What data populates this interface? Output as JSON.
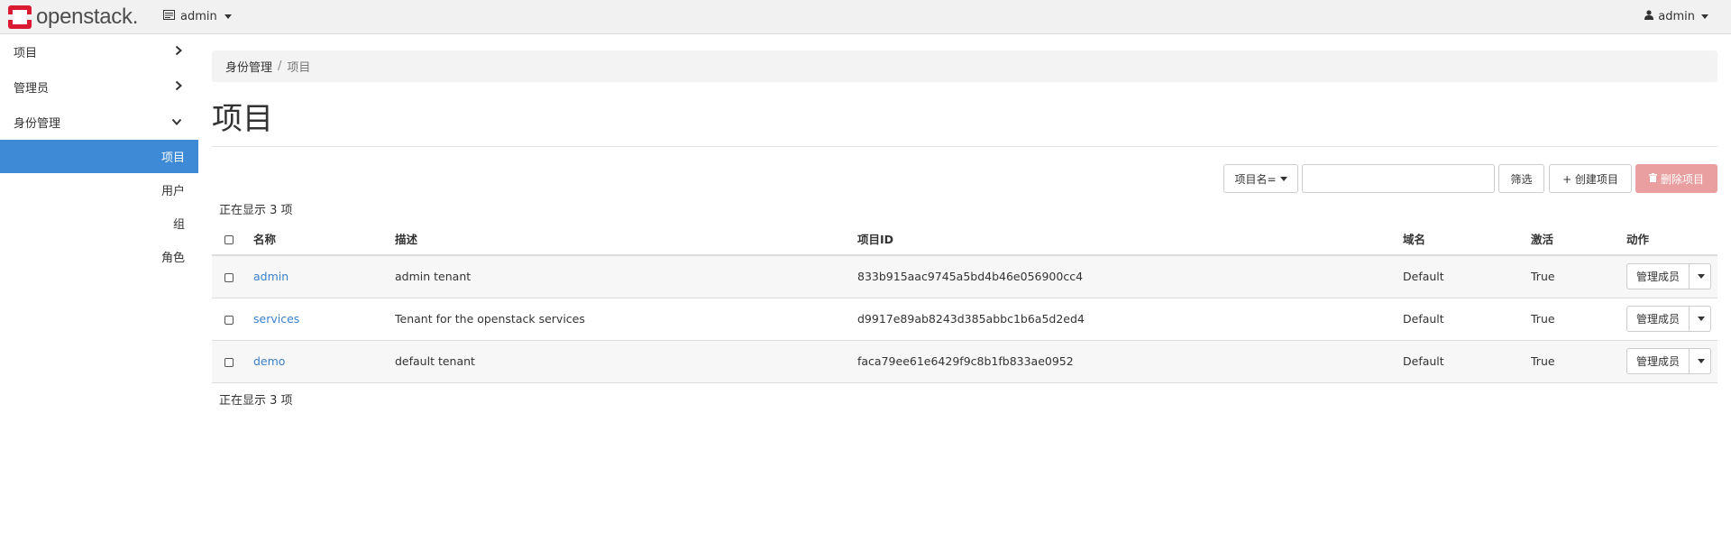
{
  "topbar": {
    "logo_text": "openstack.",
    "project_selector": "admin",
    "user": "admin",
    "icons": {
      "logo": "openstack-logo",
      "project": "project-card-icon",
      "user": "user-icon"
    }
  },
  "sidebar": {
    "items": [
      {
        "label": "项目",
        "state": "collapsed"
      },
      {
        "label": "管理员",
        "state": "collapsed"
      },
      {
        "label": "身份管理",
        "state": "expanded"
      }
    ],
    "identity_children": [
      {
        "label": "项目",
        "active": true
      },
      {
        "label": "用户",
        "active": false
      },
      {
        "label": "组",
        "active": false
      },
      {
        "label": "角色",
        "active": false
      }
    ]
  },
  "breadcrumb": {
    "parent": "身份管理",
    "separator": "/",
    "current": "项目"
  },
  "page": {
    "title": "项目"
  },
  "filter": {
    "field_selector": "项目名=",
    "value": "",
    "filter_button": "筛选",
    "create_button": "+ 创建项目",
    "delete_button": "删除项目"
  },
  "count_text_top": "正在显示 3 项",
  "count_text_bottom": "正在显示 3 项",
  "table": {
    "headers": {
      "name": "名称",
      "description": "描述",
      "project_id": "项目ID",
      "domain": "域名",
      "enabled": "激活",
      "actions": "动作"
    },
    "rows": [
      {
        "name": "admin",
        "description": "admin tenant",
        "project_id": "833b915aac9745a5bd4b46e056900cc4",
        "domain": "Default",
        "enabled": "True",
        "action": "管理成员"
      },
      {
        "name": "services",
        "description": "Tenant for the openstack services",
        "project_id": "d9917e89ab8243d385abbc1b6a5d2ed4",
        "domain": "Default",
        "enabled": "True",
        "action": "管理成员"
      },
      {
        "name": "demo",
        "description": "default tenant",
        "project_id": "faca79ee61e6429f9c8b1fb833ae0952",
        "domain": "Default",
        "enabled": "True",
        "action": "管理成员"
      }
    ]
  },
  "colors": {
    "accent": "#3f8ad7",
    "link": "#3a7fc9",
    "danger": "#e99ea0",
    "logo_red": "#da1a32"
  }
}
